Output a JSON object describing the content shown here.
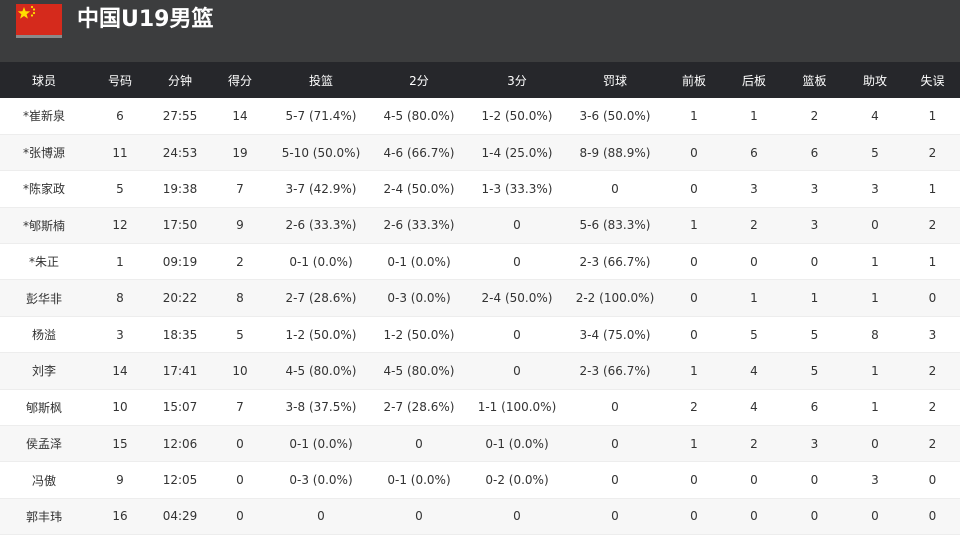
{
  "team": {
    "name": "中国U19男篮",
    "flag_colors": {
      "field": "#d52a1c",
      "stars": "#ffde00"
    }
  },
  "columns": [
    "球员",
    "号码",
    "分钟",
    "得分",
    "投篮",
    "2分",
    "3分",
    "罚球",
    "前板",
    "后板",
    "篮板",
    "助攻",
    "失误"
  ],
  "rows": [
    [
      "*崔新泉",
      "6",
      "27:55",
      "14",
      "5-7 (71.4%)",
      "4-5 (80.0%)",
      "1-2 (50.0%)",
      "3-6 (50.0%)",
      "1",
      "1",
      "2",
      "4",
      "1"
    ],
    [
      "*张博源",
      "11",
      "24:53",
      "19",
      "5-10 (50.0%)",
      "4-6 (66.7%)",
      "1-4 (25.0%)",
      "8-9 (88.9%)",
      "0",
      "6",
      "6",
      "5",
      "2"
    ],
    [
      "*陈家政",
      "5",
      "19:38",
      "7",
      "3-7 (42.9%)",
      "2-4 (50.0%)",
      "1-3 (33.3%)",
      "0",
      "0",
      "3",
      "3",
      "3",
      "1"
    ],
    [
      "*郇斯楠",
      "12",
      "17:50",
      "9",
      "2-6 (33.3%)",
      "2-6 (33.3%)",
      "0",
      "5-6 (83.3%)",
      "1",
      "2",
      "3",
      "0",
      "2"
    ],
    [
      "*朱正",
      "1",
      "09:19",
      "2",
      "0-1 (0.0%)",
      "0-1 (0.0%)",
      "0",
      "2-3 (66.7%)",
      "0",
      "0",
      "0",
      "1",
      "1"
    ],
    [
      "彭华非",
      "8",
      "20:22",
      "8",
      "2-7 (28.6%)",
      "0-3 (0.0%)",
      "2-4 (50.0%)",
      "2-2 (100.0%)",
      "0",
      "1",
      "1",
      "1",
      "0"
    ],
    [
      "杨溢",
      "3",
      "18:35",
      "5",
      "1-2 (50.0%)",
      "1-2 (50.0%)",
      "0",
      "3-4 (75.0%)",
      "0",
      "5",
      "5",
      "8",
      "3"
    ],
    [
      "刘李",
      "14",
      "17:41",
      "10",
      "4-5 (80.0%)",
      "4-5 (80.0%)",
      "0",
      "2-3 (66.7%)",
      "1",
      "4",
      "5",
      "1",
      "2"
    ],
    [
      "郇斯枫",
      "10",
      "15:07",
      "7",
      "3-8 (37.5%)",
      "2-7 (28.6%)",
      "1-1 (100.0%)",
      "0",
      "2",
      "4",
      "6",
      "1",
      "2"
    ],
    [
      "侯孟泽",
      "15",
      "12:06",
      "0",
      "0-1 (0.0%)",
      "0",
      "0-1 (0.0%)",
      "0",
      "1",
      "2",
      "3",
      "0",
      "2"
    ],
    [
      "冯傲",
      "9",
      "12:05",
      "0",
      "0-3 (0.0%)",
      "0-1 (0.0%)",
      "0-2 (0.0%)",
      "0",
      "0",
      "0",
      "0",
      "3",
      "0"
    ],
    [
      "郭丰玮",
      "16",
      "04:29",
      "0",
      "0",
      "0",
      "0",
      "0",
      "0",
      "0",
      "0",
      "0",
      "0"
    ]
  ]
}
